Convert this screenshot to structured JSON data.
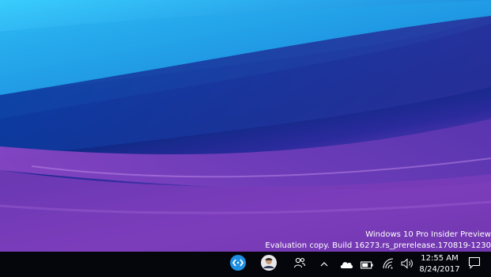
{
  "watermark": {
    "line1": "Windows 10 Pro Insider Preview",
    "line2": "Evaluation copy. Build 16273.rs_prerelease.170819-1230"
  },
  "taskbar": {
    "pinned": [
      {
        "icon": "remote-desktop-icon"
      },
      {
        "icon": "user-avatar-icon"
      }
    ],
    "tray": [
      {
        "icon": "people-icon"
      },
      {
        "icon": "chevron-up-icon"
      },
      {
        "icon": "onedrive-cloud-icon"
      },
      {
        "icon": "battery-icon"
      },
      {
        "icon": "wifi-icon"
      },
      {
        "icon": "volume-icon"
      }
    ],
    "clock": {
      "time": "12:55 AM",
      "date": "8/24/2017"
    },
    "action_center": {
      "icon": "notification-icon"
    }
  },
  "colors": {
    "taskbar_bg": "#05060c",
    "accent": "#1e8fe1"
  }
}
